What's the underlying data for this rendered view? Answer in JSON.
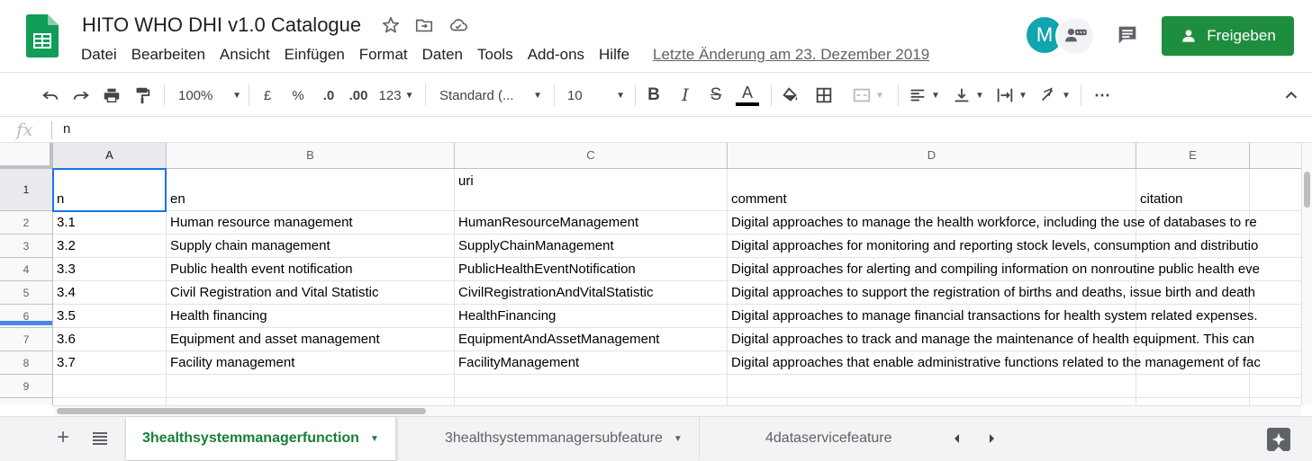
{
  "doc": {
    "title": "HITO WHO DHI v1.0 Catalogue",
    "last_edit": "Letzte Änderung am 23. Dezember 2019"
  },
  "menu": [
    "Datei",
    "Bearbeiten",
    "Ansicht",
    "Einfügen",
    "Format",
    "Daten",
    "Tools",
    "Add-ons",
    "Hilfe"
  ],
  "account": {
    "avatar_initial": "M",
    "share_label": "Freigeben",
    "brand_color": "#1e8e3e",
    "avatar_color": "#12a4af"
  },
  "toolbar": {
    "zoom": "100%",
    "currency": "£",
    "percent": "%",
    "decimal_decrease": ".0",
    "decimal_increase": ".00",
    "more_formats": "123",
    "font": "Standard (...",
    "font_size": "10",
    "icons": [
      "undo-icon",
      "redo-icon",
      "print-icon",
      "paint-format-icon",
      "bold-icon",
      "italic-icon",
      "strikethrough-icon",
      "text-color-icon",
      "fill-color-icon",
      "borders-icon",
      "merge-cells-icon",
      "horizontal-align-icon",
      "vertical-align-icon",
      "text-wrap-icon",
      "text-rotation-icon",
      "more-icon",
      "collapse-icon"
    ]
  },
  "formula_bar": {
    "fx": "fx",
    "value": "n"
  },
  "grid": {
    "columns": [
      "A",
      "B",
      "C",
      "D",
      "E"
    ],
    "rows": [
      "1",
      "2",
      "3",
      "4",
      "5",
      "6",
      "7",
      "8",
      "9"
    ],
    "header_row": {
      "a": "n",
      "b": "en",
      "c_top": "uri",
      "d": "comment",
      "e": "citation"
    },
    "data_rows": [
      {
        "n": "3.1",
        "en": "Human resource management",
        "uri": "HumanResourceManagement",
        "comment": "Digital approaches to manage the health workforce, including the use of databases to re"
      },
      {
        "n": "3.2",
        "en": "Supply chain management",
        "uri": "SupplyChainManagement",
        "comment": "Digital approaches for monitoring and reporting stock levels, consumption and distributio"
      },
      {
        "n": "3.3",
        "en": "Public health event notification",
        "uri": "PublicHealthEventNotification",
        "comment": "Digital approaches for alerting and compiling information on nonroutine public health eve"
      },
      {
        "n": "3.4",
        "en": "Civil Registration and Vital Statistic",
        "uri": "CivilRegistrationAndVitalStatistic",
        "comment": "Digital approaches to support the registration of births and deaths, issue birth and death"
      },
      {
        "n": "3.5",
        "en": "Health financing",
        "uri": "HealthFinancing",
        "comment": "Digital approaches to manage financial transactions for health system related expenses."
      },
      {
        "n": "3.6",
        "en": "Equipment and asset management",
        "uri": "EquipmentAndAssetManagement",
        "comment": "Digital approaches to track and manage the maintenance of health equipment. This can"
      },
      {
        "n": "3.7",
        "en": "Facility management",
        "uri": "FacilityManagement",
        "comment": "Digital approaches that enable administrative functions related to the management of fac"
      }
    ]
  },
  "sheets": [
    "3healthsystemmanagerfunction",
    "3healthsystemmanagersubfeature",
    "4dataservicefeature"
  ],
  "active_sheet_color": "#188038"
}
